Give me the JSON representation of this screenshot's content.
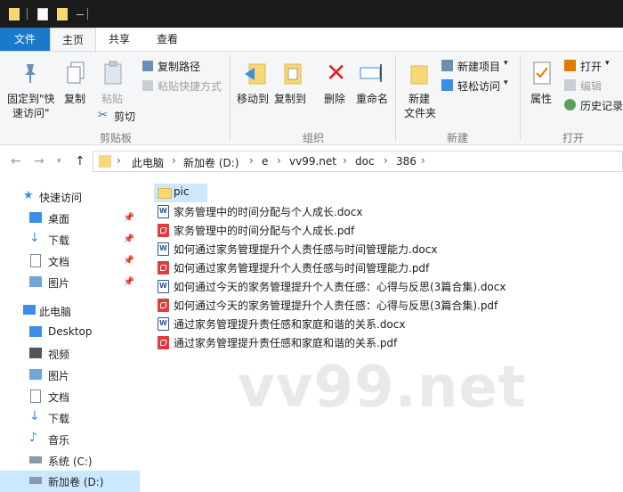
{
  "ribbon_tabs": {
    "file": "文件",
    "home": "主页",
    "share": "共享",
    "view": "查看"
  },
  "ribbon": {
    "pin_quick_line1": "固定到\"快",
    "pin_quick_line2": "速访问\"",
    "copy": "复制",
    "paste": "粘贴",
    "copy_path": "复制路径",
    "paste_shortcut": "粘贴快捷方式",
    "cut": "剪切",
    "clipboard_group": "剪贴板",
    "move_to": "移动到",
    "copy_to": "复制到",
    "delete": "删除",
    "rename": "重命名",
    "organize_group": "组织",
    "new_folder_line1": "新建",
    "new_folder_line2": "文件夹",
    "new_item": "新建项目",
    "easy_access": "轻松访问",
    "new_group": "新建",
    "properties": "属性",
    "open": "打开",
    "edit": "编辑",
    "history": "历史记录",
    "open_group": "打开"
  },
  "breadcrumb": [
    "此电脑",
    "新加卷 (D:)",
    "e",
    "vv99.net",
    "doc",
    "386"
  ],
  "sidebar": {
    "quick_access": "快速访问",
    "quick_items": [
      "桌面",
      "下载",
      "文档",
      "图片"
    ],
    "this_pc": "此电脑",
    "pc_items": [
      "Desktop",
      "视频",
      "图片",
      "文档",
      "下载",
      "音乐",
      "系统 (C:)",
      "新加卷 (D:)"
    ]
  },
  "files": [
    {
      "name": "pic",
      "type": "folder"
    },
    {
      "name": "家务管理中的时间分配与个人成长.docx",
      "type": "docx"
    },
    {
      "name": "家务管理中的时间分配与个人成长.pdf",
      "type": "pdf"
    },
    {
      "name": "如何通过家务管理提升个人责任感与时间管理能力.docx",
      "type": "docx"
    },
    {
      "name": "如何通过家务管理提升个人责任感与时间管理能力.pdf",
      "type": "pdf"
    },
    {
      "name": "如何通过今天的家务管理提升个人责任感：心得与反思(3篇合集).docx",
      "type": "docx"
    },
    {
      "name": "如何通过今天的家务管理提升个人责任感：心得与反思(3篇合集).pdf",
      "type": "pdf"
    },
    {
      "name": "通过家务管理提升责任感和家庭和谐的关系.docx",
      "type": "docx"
    },
    {
      "name": "通过家务管理提升责任感和家庭和谐的关系.pdf",
      "type": "pdf"
    }
  ],
  "watermark": "vv99.net",
  "colors": {
    "accent": "#1979ca",
    "selection": "#cce8ff",
    "titlebar": "#1b1b1b",
    "folder": "#f8d775",
    "pdf": "#e23b3b",
    "word": "#2b5797"
  }
}
